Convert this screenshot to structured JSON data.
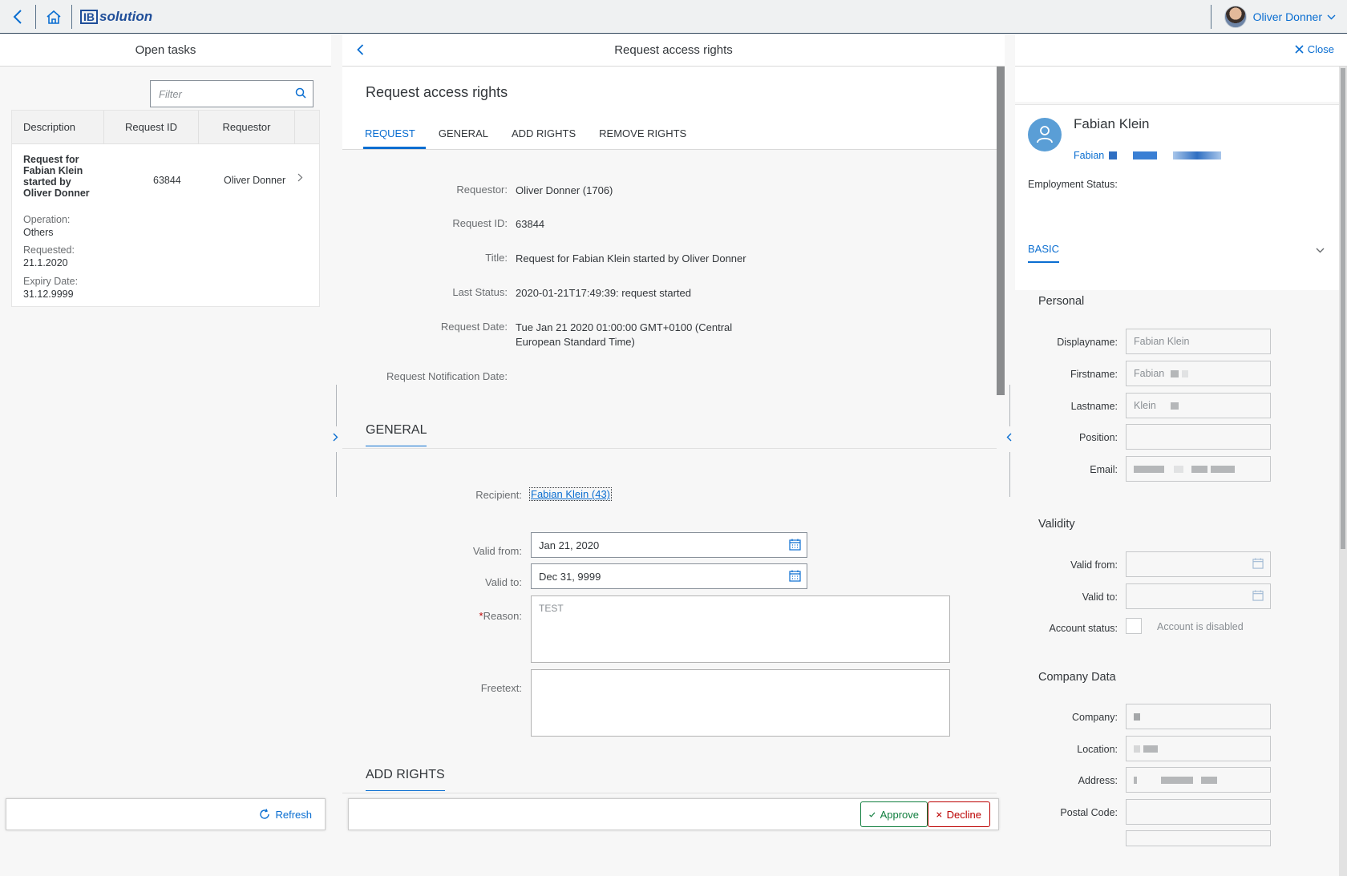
{
  "shell": {
    "logo_mark": "IB",
    "logo_text": "solution",
    "user_name": "Oliver Donner"
  },
  "tasks": {
    "title": "Open tasks",
    "filter_placeholder": "Filter",
    "columns": [
      "Description",
      "Request ID",
      "Requestor"
    ],
    "row": {
      "description": "Request for Fabian Klein started by Oliver Donner",
      "request_id": "63844",
      "requestor": "Oliver Donner",
      "operation_label": "Operation:",
      "operation_value": "Others",
      "requested_label": "Requested:",
      "requested_value": "21.1.2020",
      "expiry_label": "Expiry Date:",
      "expiry_value": "31.12.9999"
    },
    "refresh": "Refresh"
  },
  "detail": {
    "header": "Request access rights",
    "title": "Request access rights",
    "tabs": [
      "REQUEST",
      "GENERAL",
      "ADD RIGHTS",
      "REMOVE RIGHTS"
    ],
    "fields": {
      "requestor_label": "Requestor:",
      "requestor_value": "Oliver Donner (1706)",
      "request_id_label": "Request ID:",
      "request_id_value": "63844",
      "title_label": "Title:",
      "title_value": "Request for Fabian Klein started by Oliver Donner",
      "last_status_label": "Last Status:",
      "last_status_value": "2020-01-21T17:49:39: request started",
      "request_date_label": "Request Date:",
      "request_date_line1": "Tue Jan 21 2020 01:00:00 GMT+0100 (Central",
      "request_date_line2": "European Standard Time)",
      "notification_label": "Request Notification Date:"
    },
    "general": {
      "heading": "GENERAL",
      "recipient_label": "Recipient:",
      "recipient_value": "Fabian Klein (43)",
      "valid_from_label": "Valid from:",
      "valid_from_value": "Jan 21, 2020",
      "valid_to_label": "Valid to:",
      "valid_to_value": "Dec 31, 9999",
      "reason_required": "*",
      "reason_label": "Reason:",
      "reason_value": "TEST",
      "freetext_label": "Freetext:"
    },
    "add_rights_heading": "ADD RIGHTS",
    "approve": "Approve",
    "decline": "Decline"
  },
  "profile": {
    "close": "Close",
    "name": "Fabian Klein",
    "subtitle": "Fabian",
    "employment_label": "Employment Status:",
    "tab": "BASIC",
    "personal": {
      "heading": "Personal",
      "displayname_label": "Displayname:",
      "displayname_value": "Fabian Klein",
      "firstname_label": "Firstname:",
      "firstname_value": "Fabian",
      "lastname_label": "Lastname:",
      "lastname_value": "Klein",
      "position_label": "Position:",
      "email_label": "Email:"
    },
    "validity": {
      "heading": "Validity",
      "valid_from_label": "Valid from:",
      "valid_to_label": "Valid to:",
      "account_status_label": "Account status:",
      "account_status_text": "Account is disabled"
    },
    "company": {
      "heading": "Company Data",
      "company_label": "Company:",
      "location_label": "Location:",
      "address_label": "Address:",
      "postal_label": "Postal Code:"
    }
  },
  "colors": {
    "accent": "#0a6ed1",
    "approve": "#107e3e",
    "decline": "#bb0000"
  }
}
